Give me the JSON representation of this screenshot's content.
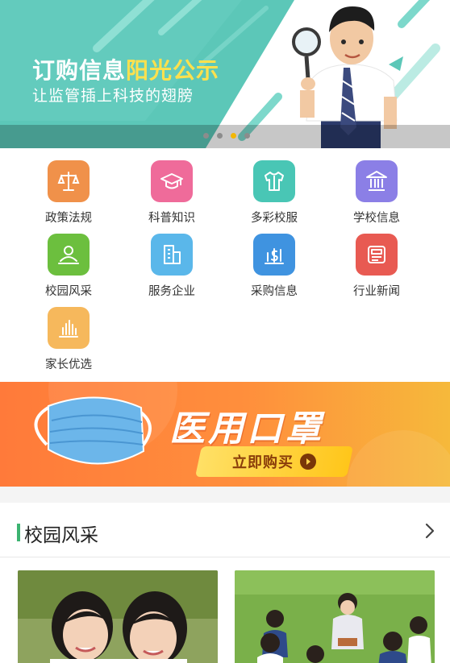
{
  "hero": {
    "title_part1": "订购信息",
    "title_part2": "阳光公示",
    "subtitle": "让监管插上科技的翅膀",
    "slide_count": 4,
    "active_slide": 3,
    "colors": {
      "teal": "#5cc7b8",
      "highlight": "#ffe14d"
    }
  },
  "categories": [
    {
      "label": "政策法规",
      "icon": "scale-icon",
      "color": "#f0914a"
    },
    {
      "label": "科普知识",
      "icon": "graduation-cap-icon",
      "color": "#ef6b9a"
    },
    {
      "label": "多彩校服",
      "icon": "shirt-icon",
      "color": "#49c6b5"
    },
    {
      "label": "学校信息",
      "icon": "school-building-icon",
      "color": "#8b7fe6"
    },
    {
      "label": "校园风采",
      "icon": "person-icon",
      "color": "#6cbf3e"
    },
    {
      "label": "服务企业",
      "icon": "office-building-icon",
      "color": "#5ab7ea"
    },
    {
      "label": "采购信息",
      "icon": "purchase-chart-icon",
      "color": "#3f93e0"
    },
    {
      "label": "行业新闻",
      "icon": "news-icon",
      "color": "#e85a52"
    },
    {
      "label": "家长优选",
      "icon": "bar-chart-icon",
      "color": "#f6b85c"
    }
  ],
  "promo": {
    "title": "医用口罩",
    "button_label": "立即购买",
    "colors": {
      "from": "#ff8a3a",
      "to": "#f6b93b"
    }
  },
  "section": {
    "title": "校园风采",
    "accent": "#3cb371"
  }
}
